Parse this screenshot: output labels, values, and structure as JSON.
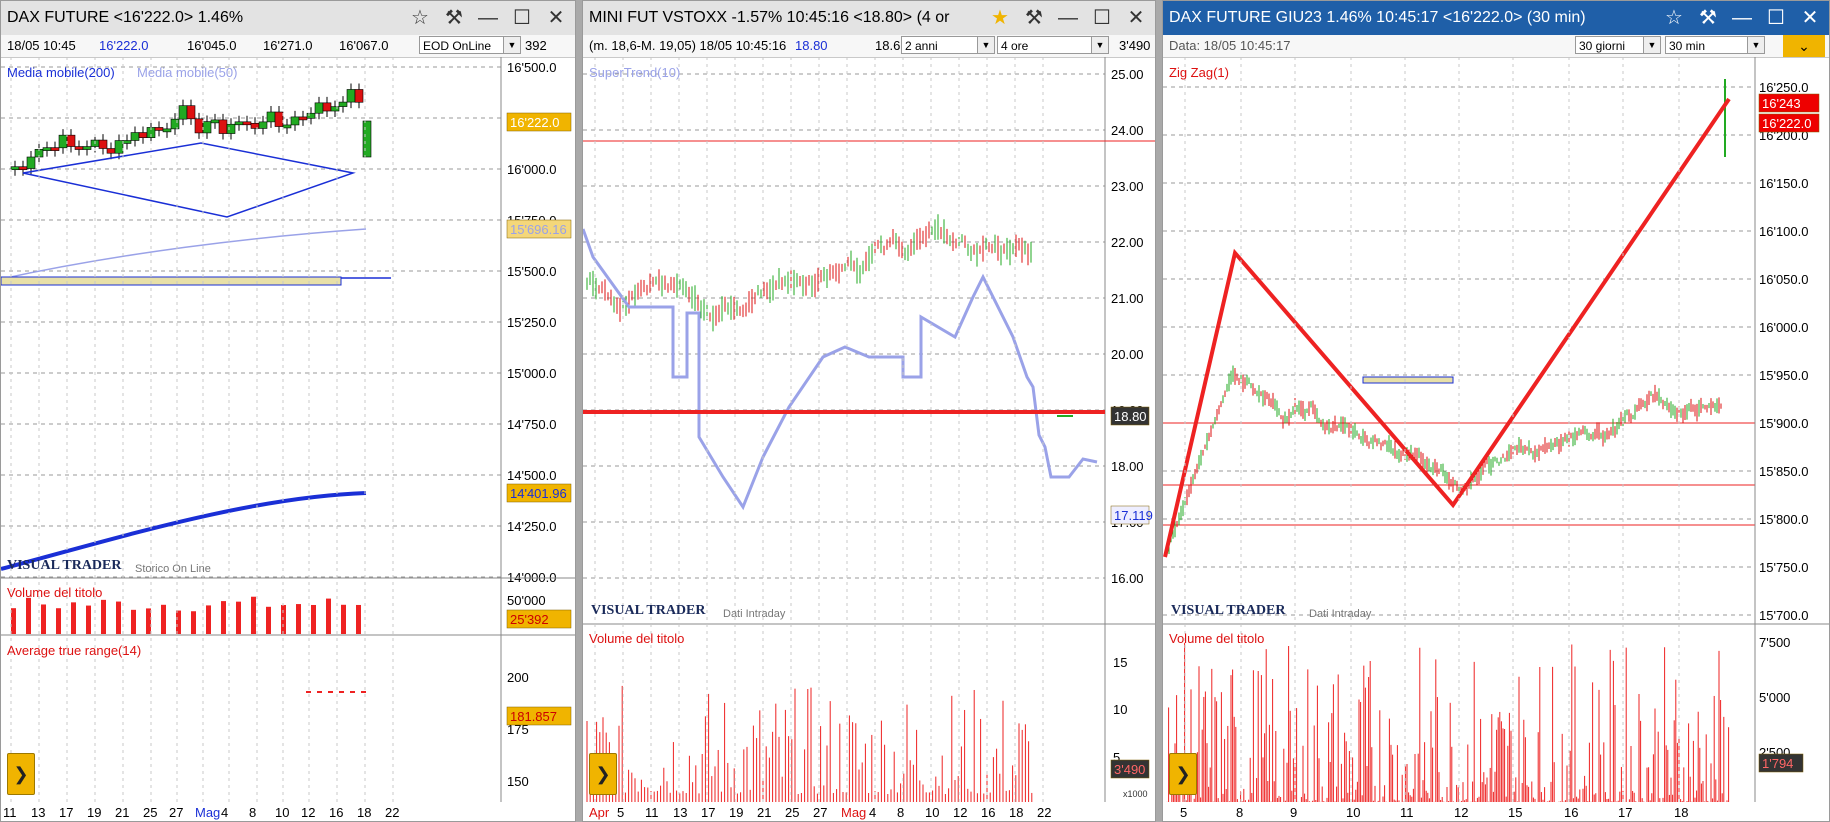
{
  "panels": [
    {
      "title": "DAX FUTURE <16'222.0> 1.46%",
      "info": [
        "18/05 10:45",
        "16'222.0",
        "16'045.0",
        "16'271.0",
        "16'067.0"
      ],
      "info_extra": "392",
      "select": "EOD OnLine",
      "indicator_labels": [
        "Media mobile(200)",
        "Media mobile(50)"
      ],
      "price_badges": [
        "16'222.0",
        "15'696.16",
        "14'401.96"
      ],
      "y_ticks": [
        "16'500.0",
        "16'250.0",
        "16'000.0",
        "15'750.0",
        "15'500.0",
        "15'250.0",
        "15'000.0",
        "14'750.0",
        "14'500.0",
        "14'250.0",
        "14'000.0"
      ],
      "brand": "VISUAL TRADER",
      "brand_sub": "Storico On Line",
      "volume_label": "Volume del titolo",
      "volume_ticks": [
        "50'000"
      ],
      "volume_badge": "25'392",
      "atr_label": "Average true range(14)",
      "atr_ticks": [
        "200",
        "175",
        "150"
      ],
      "atr_badge": "181.857",
      "x_ticks": [
        "11",
        "13",
        "17",
        "19",
        "21",
        "25",
        "27",
        "Mag",
        "4",
        "8",
        "10",
        "12",
        "16",
        "18",
        "22"
      ]
    },
    {
      "title": "MINI FUT VSTOXX -1.57% 10:45:16 <18.80> (4 or",
      "info": "(m. 18,6-M. 19,05) 18/05 10:45:16",
      "info_value": "18.80",
      "info_extra": "18.6",
      "info_extra2": "3'490",
      "select1": "2 anni",
      "select2": "4 ore",
      "indicator_labels": [
        "SuperTrend(10)"
      ],
      "price_badges": [
        "18.80",
        "17.119"
      ],
      "y_ticks": [
        "25.00",
        "24.00",
        "23.00",
        "22.00",
        "21.00",
        "20.00",
        "19.00",
        "18.00",
        "17.00",
        "16.00"
      ],
      "brand": "VISUAL TRADER",
      "brand_sub": "Dati Intraday",
      "volume_label": "Volume del titolo",
      "volume_ticks": [
        "15",
        "10",
        "5"
      ],
      "volume_badge": "3'490",
      "volume_mult": "x1000",
      "x_ticks": [
        "Apr",
        "5",
        "11",
        "13",
        "17",
        "19",
        "21",
        "25",
        "27",
        "Mag",
        "4",
        "8",
        "10",
        "12",
        "16",
        "18",
        "22"
      ]
    },
    {
      "title": "DAX FUTURE GIU23 1.46% 10:45:17 <16'222.0> (30 min)",
      "info": "Data: 18/05 10:45:17",
      "select1": "30 giorni",
      "select2": "30 min",
      "indicator_labels": [
        "Zig Zag(1)"
      ],
      "price_badges": [
        "16'243",
        "16'222.0"
      ],
      "y_ticks": [
        "16'250.0",
        "16'200.0",
        "16'150.0",
        "16'100.0",
        "16'050.0",
        "16'000.0",
        "15'950.0",
        "15'900.0",
        "15'850.0",
        "15'800.0",
        "15'750.0",
        "15'700.0"
      ],
      "brand": "VISUAL TRADER",
      "brand_sub": "Dati Intraday",
      "volume_label": "Volume del titolo",
      "volume_ticks": [
        "7'500",
        "5'000",
        "2'500"
      ],
      "volume_badge": "1'794",
      "x_ticks": [
        "5",
        "8",
        "9",
        "10",
        "11",
        "12",
        "15",
        "16",
        "17",
        "18"
      ]
    }
  ],
  "colors": {
    "up": "#22aa22",
    "down": "#dd1111",
    "ma200": "#1a2fd6",
    "ma50": "#9aa2e8",
    "badge": "#f0b400",
    "red": "#ee2222"
  }
}
